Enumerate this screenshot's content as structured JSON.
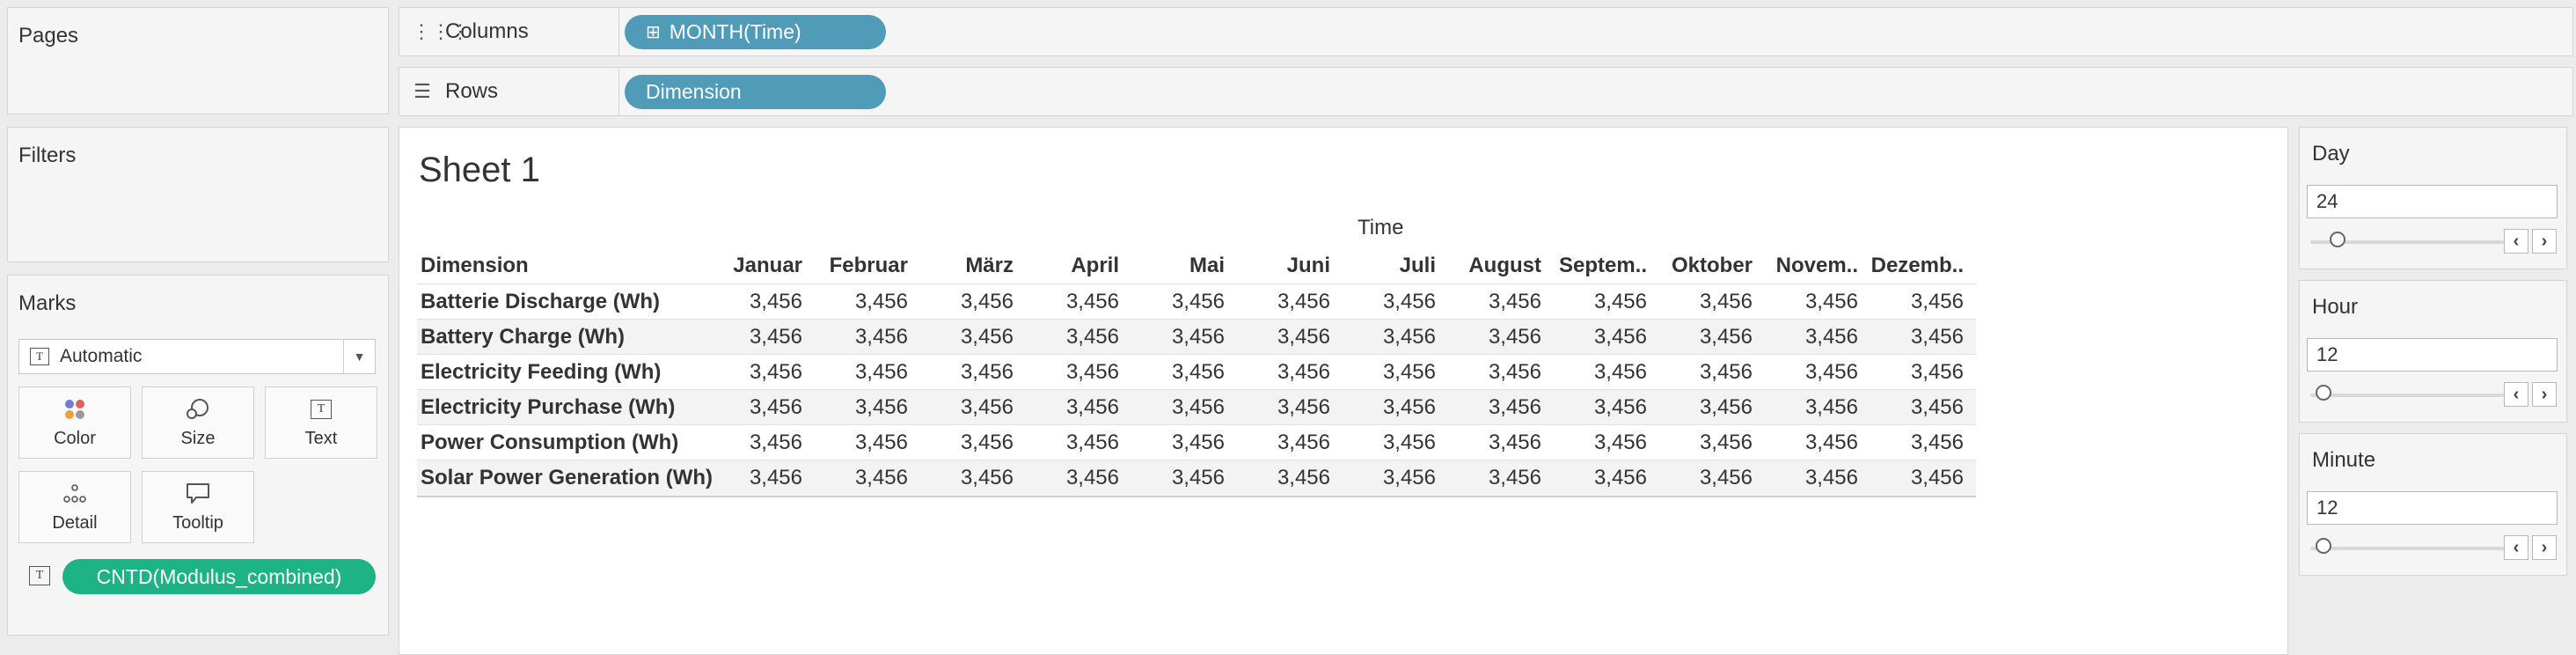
{
  "pages": {
    "title": "Pages"
  },
  "filters": {
    "title": "Filters"
  },
  "columns_shelf": {
    "label": "Columns",
    "icon": "columns-icon",
    "pill": "MONTH(Time)",
    "pill_icon": "expand-plus-icon"
  },
  "rows_shelf": {
    "label": "Rows",
    "icon": "rows-list-icon",
    "pill": "Dimension"
  },
  "marks": {
    "title": "Marks",
    "type": "Automatic",
    "buttons": [
      {
        "label": "Color",
        "icon": "color-dots-icon"
      },
      {
        "label": "Size",
        "icon": "size-icon"
      },
      {
        "label": "Text",
        "icon": "text-icon"
      },
      {
        "label": "Detail",
        "icon": "detail-dots-icon"
      },
      {
        "label": "Tooltip",
        "icon": "tooltip-icon"
      }
    ],
    "field": {
      "icon": "text-icon",
      "label": "CNTD(Modulus_combined)"
    },
    "colors": {
      "pill": "#1db385"
    }
  },
  "sheet": {
    "title": "Sheet 1",
    "column_group": "Time",
    "row_header": "Dimension",
    "months": [
      "Januar",
      "Februar",
      "März",
      "April",
      "Mai",
      "Juni",
      "Juli",
      "August",
      "Septem..",
      "Oktober",
      "Novem..",
      "Dezemb.."
    ],
    "rows": [
      {
        "name": "Batterie Discharge (Wh)",
        "values": [
          "3,456",
          "3,456",
          "3,456",
          "3,456",
          "3,456",
          "3,456",
          "3,456",
          "3,456",
          "3,456",
          "3,456",
          "3,456",
          "3,456"
        ]
      },
      {
        "name": "Battery Charge (Wh)",
        "values": [
          "3,456",
          "3,456",
          "3,456",
          "3,456",
          "3,456",
          "3,456",
          "3,456",
          "3,456",
          "3,456",
          "3,456",
          "3,456",
          "3,456"
        ]
      },
      {
        "name": "Electricity Feeding (Wh)",
        "values": [
          "3,456",
          "3,456",
          "3,456",
          "3,456",
          "3,456",
          "3,456",
          "3,456",
          "3,456",
          "3,456",
          "3,456",
          "3,456",
          "3,456"
        ]
      },
      {
        "name": "Electricity Purchase (Wh)",
        "values": [
          "3,456",
          "3,456",
          "3,456",
          "3,456",
          "3,456",
          "3,456",
          "3,456",
          "3,456",
          "3,456",
          "3,456",
          "3,456",
          "3,456"
        ]
      },
      {
        "name": "Power Consumption (Wh)",
        "values": [
          "3,456",
          "3,456",
          "3,456",
          "3,456",
          "3,456",
          "3,456",
          "3,456",
          "3,456",
          "3,456",
          "3,456",
          "3,456",
          "3,456"
        ]
      },
      {
        "name": "Solar Power Generation (Wh)",
        "values": [
          "3,456",
          "3,456",
          "3,456",
          "3,456",
          "3,456",
          "3,456",
          "3,456",
          "3,456",
          "3,456",
          "3,456",
          "3,456",
          "3,456"
        ]
      }
    ]
  },
  "parameter_cards": [
    {
      "title": "Day",
      "value": "24",
      "slider_fraction": 0.14
    },
    {
      "title": "Hour",
      "value": "12",
      "slider_fraction": 0.07
    },
    {
      "title": "Minute",
      "value": "12",
      "slider_fraction": 0.07
    }
  ],
  "colors": {
    "shelf_pill": "#4f9bb8",
    "marks_pill": "#1db385",
    "background": "#ececec"
  }
}
